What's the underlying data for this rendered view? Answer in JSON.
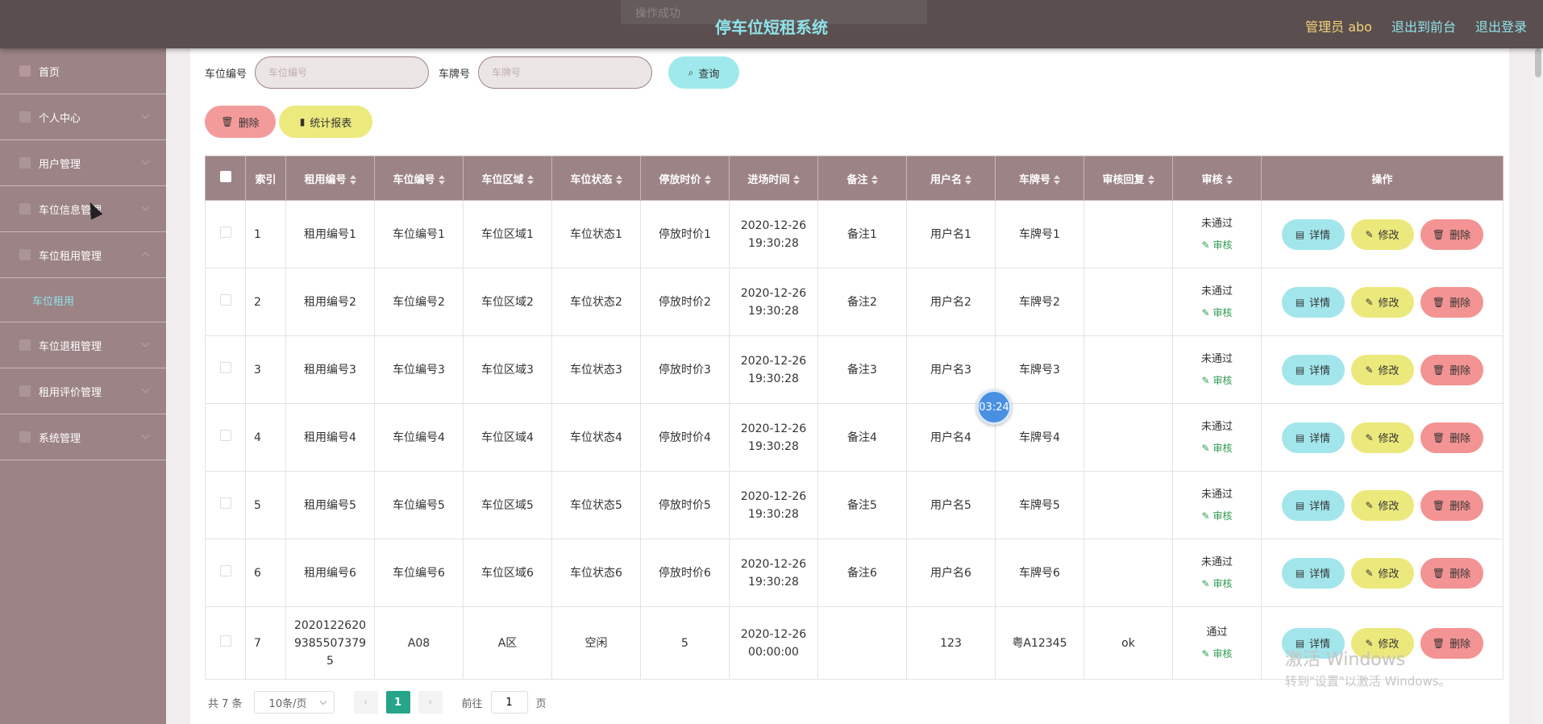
{
  "header": {
    "title": "停车位短租系统",
    "admin": "管理员 abo",
    "front": "退出到前台",
    "logout": "退出登录"
  },
  "sidebar": {
    "items": [
      {
        "label": "首页",
        "icon": "home-icon"
      },
      {
        "label": "个人中心",
        "icon": "user-icon"
      },
      {
        "label": "用户管理",
        "icon": "users-icon"
      },
      {
        "label": "车位信息管理",
        "icon": "parking-icon"
      },
      {
        "label": "车位租用管理",
        "icon": "rent-icon"
      },
      {
        "label": "车位退租管理",
        "icon": "return-icon"
      },
      {
        "label": "租用评价管理",
        "icon": "review-icon"
      },
      {
        "label": "系统管理",
        "icon": "system-icon"
      }
    ],
    "submenu": "车位租用"
  },
  "search": {
    "label1": "车位编号",
    "placeholder1": "车位编号",
    "label2": "车牌号",
    "placeholder2": "车牌号",
    "button": "查询"
  },
  "actions": {
    "delete": "删除",
    "report": "统计报表"
  },
  "table": {
    "headers": [
      "索引",
      "租用编号",
      "车位编号",
      "车位区域",
      "车位状态",
      "停放时价",
      "进场时间",
      "备注",
      "用户名",
      "车牌号",
      "审核回复",
      "审核",
      "操作"
    ],
    "rows": [
      {
        "idx": "1",
        "rent": "租用编号1",
        "spot": "车位编号1",
        "area": "车位区域1",
        "status": "车位状态1",
        "price": "停放时价1",
        "time1": "2020-12-26",
        "time2": "19:30:28",
        "note": "备注1",
        "user": "用户名1",
        "plate": "车牌号1",
        "reply": "",
        "audit": "未通过"
      },
      {
        "idx": "2",
        "rent": "租用编号2",
        "spot": "车位编号2",
        "area": "车位区域2",
        "status": "车位状态2",
        "price": "停放时价2",
        "time1": "2020-12-26",
        "time2": "19:30:28",
        "note": "备注2",
        "user": "用户名2",
        "plate": "车牌号2",
        "reply": "",
        "audit": "未通过"
      },
      {
        "idx": "3",
        "rent": "租用编号3",
        "spot": "车位编号3",
        "area": "车位区域3",
        "status": "车位状态3",
        "price": "停放时价3",
        "time1": "2020-12-26",
        "time2": "19:30:28",
        "note": "备注3",
        "user": "用户名3",
        "plate": "车牌号3",
        "reply": "",
        "audit": "未通过"
      },
      {
        "idx": "4",
        "rent": "租用编号4",
        "spot": "车位编号4",
        "area": "车位区域4",
        "status": "车位状态4",
        "price": "停放时价4",
        "time1": "2020-12-26",
        "time2": "19:30:28",
        "note": "备注4",
        "user": "用户名4",
        "plate": "车牌号4",
        "reply": "",
        "audit": "未通过"
      },
      {
        "idx": "5",
        "rent": "租用编号5",
        "spot": "车位编号5",
        "area": "车位区域5",
        "status": "车位状态5",
        "price": "停放时价5",
        "time1": "2020-12-26",
        "time2": "19:30:28",
        "note": "备注5",
        "user": "用户名5",
        "plate": "车牌号5",
        "reply": "",
        "audit": "未通过"
      },
      {
        "idx": "6",
        "rent": "租用编号6",
        "spot": "车位编号6",
        "area": "车位区域6",
        "status": "车位状态6",
        "price": "停放时价6",
        "time1": "2020-12-26",
        "time2": "19:30:28",
        "note": "备注6",
        "user": "用户名6",
        "plate": "车牌号6",
        "reply": "",
        "audit": "未通过"
      },
      {
        "idx": "7",
        "rent": "20201226209385507379 5",
        "rent_lines": [
          "2020122620",
          "9385507379",
          "5"
        ],
        "spot": "A08",
        "area": "A区",
        "status": "空闲",
        "price": "5",
        "time1": "2020-12-26",
        "time2": "00:00:00",
        "note": "",
        "user": "123",
        "plate": "粤A12345",
        "reply": "ok",
        "audit": "通过"
      }
    ],
    "audit_link": "审核",
    "op_detail": "详情",
    "op_edit": "修改",
    "op_delete": "删除"
  },
  "pager": {
    "total": "共 7 条",
    "size": "10条/页",
    "current": "1",
    "goto": "前往",
    "page_value": "1",
    "page_unit": "页"
  },
  "overlay": {
    "timer": "03:24",
    "watermark1": "激活 Windows",
    "watermark2": "转到\"设置\"以激活 Windows。",
    "toast": "操作成功"
  },
  "colors": {
    "header_bg": "#5a4e4e",
    "sidebar_bg": "#9c8385",
    "accent_cyan": "#8fe3ea",
    "accent_yellow": "#ecea7d",
    "accent_red": "#f39b9b",
    "pager_active": "#26a58a"
  }
}
